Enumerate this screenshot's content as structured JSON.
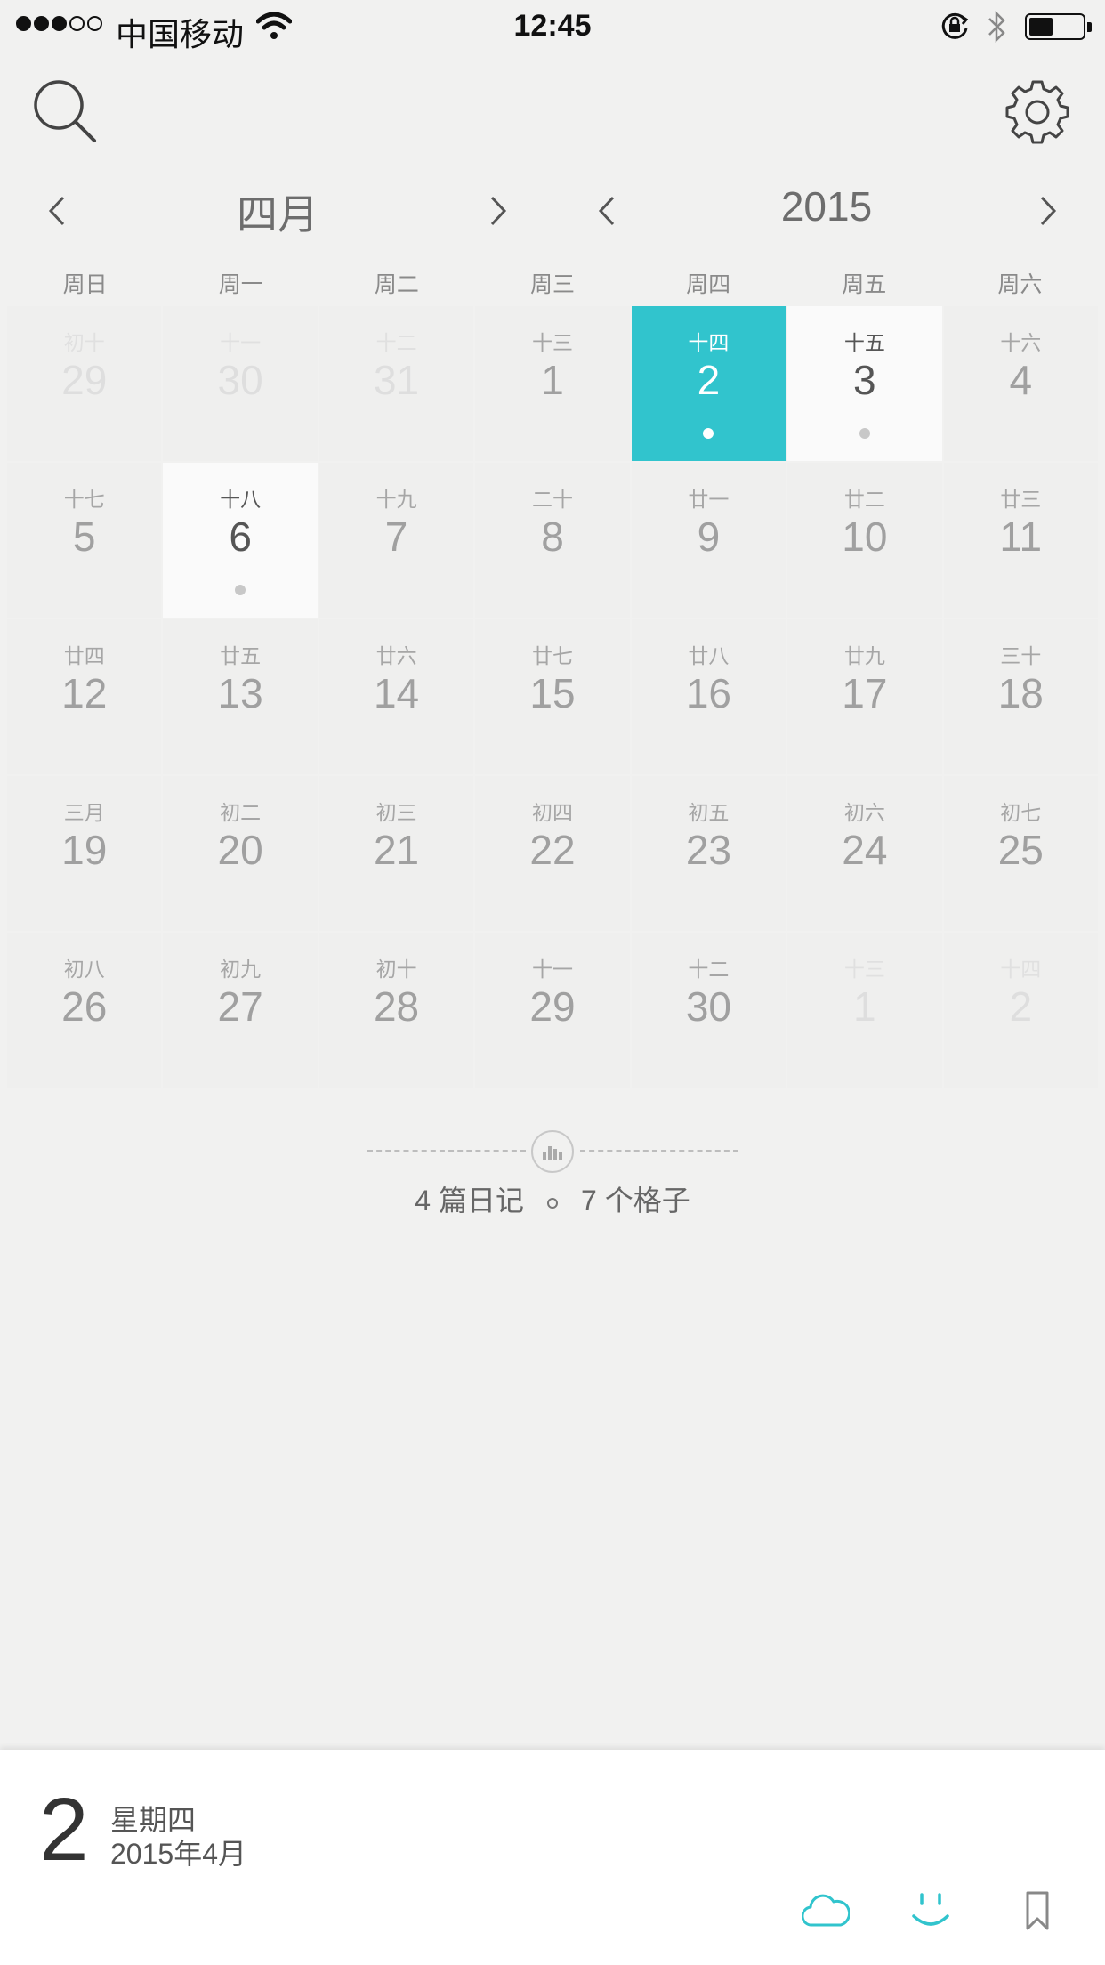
{
  "status_bar": {
    "carrier": "中国移动",
    "time": "12:45"
  },
  "nav": {
    "month_label": "四月",
    "year_label": "2015"
  },
  "weekdays": [
    "周日",
    "周一",
    "周二",
    "周三",
    "周四",
    "周五",
    "周六"
  ],
  "calendar": [
    [
      {
        "lunar": "初十",
        "day": "29",
        "state": "other"
      },
      {
        "lunar": "十一",
        "day": "30",
        "state": "other"
      },
      {
        "lunar": "十二",
        "day": "31",
        "state": "other"
      },
      {
        "lunar": "十三",
        "day": "1",
        "state": "normal"
      },
      {
        "lunar": "十四",
        "day": "2",
        "state": "selected",
        "dot": true
      },
      {
        "lunar": "十五",
        "day": "3",
        "state": "entry",
        "dot": true
      },
      {
        "lunar": "十六",
        "day": "4",
        "state": "normal"
      }
    ],
    [
      {
        "lunar": "十七",
        "day": "5",
        "state": "normal"
      },
      {
        "lunar": "十八",
        "day": "6",
        "state": "entry",
        "dot": true
      },
      {
        "lunar": "十九",
        "day": "7",
        "state": "normal"
      },
      {
        "lunar": "二十",
        "day": "8",
        "state": "normal"
      },
      {
        "lunar": "廿一",
        "day": "9",
        "state": "normal"
      },
      {
        "lunar": "廿二",
        "day": "10",
        "state": "normal"
      },
      {
        "lunar": "廿三",
        "day": "11",
        "state": "normal"
      }
    ],
    [
      {
        "lunar": "廿四",
        "day": "12",
        "state": "normal"
      },
      {
        "lunar": "廿五",
        "day": "13",
        "state": "normal"
      },
      {
        "lunar": "廿六",
        "day": "14",
        "state": "normal"
      },
      {
        "lunar": "廿七",
        "day": "15",
        "state": "normal"
      },
      {
        "lunar": "廿八",
        "day": "16",
        "state": "normal"
      },
      {
        "lunar": "廿九",
        "day": "17",
        "state": "normal"
      },
      {
        "lunar": "三十",
        "day": "18",
        "state": "normal"
      }
    ],
    [
      {
        "lunar": "三月",
        "day": "19",
        "state": "normal"
      },
      {
        "lunar": "初二",
        "day": "20",
        "state": "normal"
      },
      {
        "lunar": "初三",
        "day": "21",
        "state": "normal"
      },
      {
        "lunar": "初四",
        "day": "22",
        "state": "normal"
      },
      {
        "lunar": "初五",
        "day": "23",
        "state": "normal"
      },
      {
        "lunar": "初六",
        "day": "24",
        "state": "normal"
      },
      {
        "lunar": "初七",
        "day": "25",
        "state": "normal"
      }
    ],
    [
      {
        "lunar": "初八",
        "day": "26",
        "state": "normal"
      },
      {
        "lunar": "初九",
        "day": "27",
        "state": "normal"
      },
      {
        "lunar": "初十",
        "day": "28",
        "state": "normal"
      },
      {
        "lunar": "十一",
        "day": "29",
        "state": "normal"
      },
      {
        "lunar": "十二",
        "day": "30",
        "state": "normal"
      },
      {
        "lunar": "十三",
        "day": "1",
        "state": "other"
      },
      {
        "lunar": "十四",
        "day": "2",
        "state": "other"
      }
    ]
  ],
  "summary": {
    "entries": "4 篇日记",
    "cells": "7 个格子"
  },
  "selected_day": {
    "day": "2",
    "weekday": "星期四",
    "year_month": "2015年4月"
  },
  "bottom_icons": [
    "cloud-icon",
    "smile-icon",
    "bookmark-icon"
  ],
  "colors": {
    "accent": "#31c4cd",
    "background": "#f1f1f0"
  }
}
